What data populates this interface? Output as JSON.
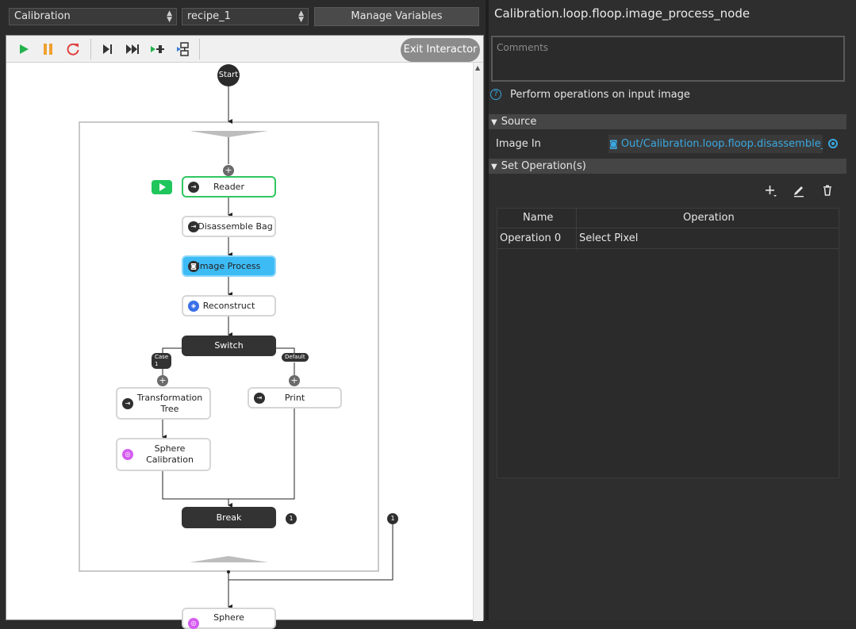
{
  "left_toolbar": {
    "graph_select": "Calibration",
    "recipe_select": "recipe_1",
    "manage_variables_label": "Manage Variables"
  },
  "canvas_toolbar": {
    "buttons": [
      {
        "name": "play-icon",
        "color": "#22b24c"
      },
      {
        "name": "pause-icon",
        "color": "#f0a030"
      },
      {
        "name": "restart-icon",
        "color": "#e04040"
      },
      {
        "name": "step-icon",
        "color": "#333333"
      },
      {
        "name": "fast-forward-icon",
        "color": "#333333"
      },
      {
        "name": "step-into-icon",
        "color": "#22b24c"
      },
      {
        "name": "step-out-icon",
        "color": "#3a7fd5"
      }
    ],
    "exit_label": "Exit Interactor"
  },
  "flow": {
    "start_label": "Start",
    "nodes": {
      "reader": {
        "label": "Reader",
        "icon": "step-icon"
      },
      "disassemble": {
        "label": "Disassemble Bag",
        "icon": "step-icon"
      },
      "image_process": {
        "label": "Image Process",
        "icon": "camera-icon"
      },
      "reconstruct": {
        "label": "Reconstruct",
        "icon": "cube-icon"
      },
      "switch": {
        "label": "Switch"
      },
      "transformation_l1": "Transformation",
      "transformation_l2": "Tree",
      "print": {
        "label": "Print",
        "icon": "step-icon"
      },
      "sphere_l1": "Sphere",
      "sphere_l2": "Calibration",
      "break": {
        "label": "Break"
      },
      "sphere_bottom": {
        "label": "Sphere"
      }
    },
    "case1_label": "Case 1",
    "default_label": "Default",
    "break_count": "1",
    "loop_count": "1",
    "plus": "+",
    "colors": {
      "running": "#2fc760",
      "selected": "#3dbbf5",
      "sphere_icon": "#d65cf0",
      "cube_icon": "#3a6fe8"
    }
  },
  "properties": {
    "title": "Calibration.loop.floop.image_process_node",
    "comments_placeholder": "Comments",
    "help_glyph": "?",
    "description": "Perform operations on input image",
    "source_section": "Source",
    "image_in_label": "Image In",
    "image_in_value": "Out/Calibration.loop.floop.disassemble_bag",
    "set_ops_section": "Set Operation(s)",
    "table": {
      "headers": [
        "Name",
        "Operation"
      ],
      "rows": [
        [
          "Operation 0",
          "Select Pixel"
        ]
      ]
    }
  }
}
